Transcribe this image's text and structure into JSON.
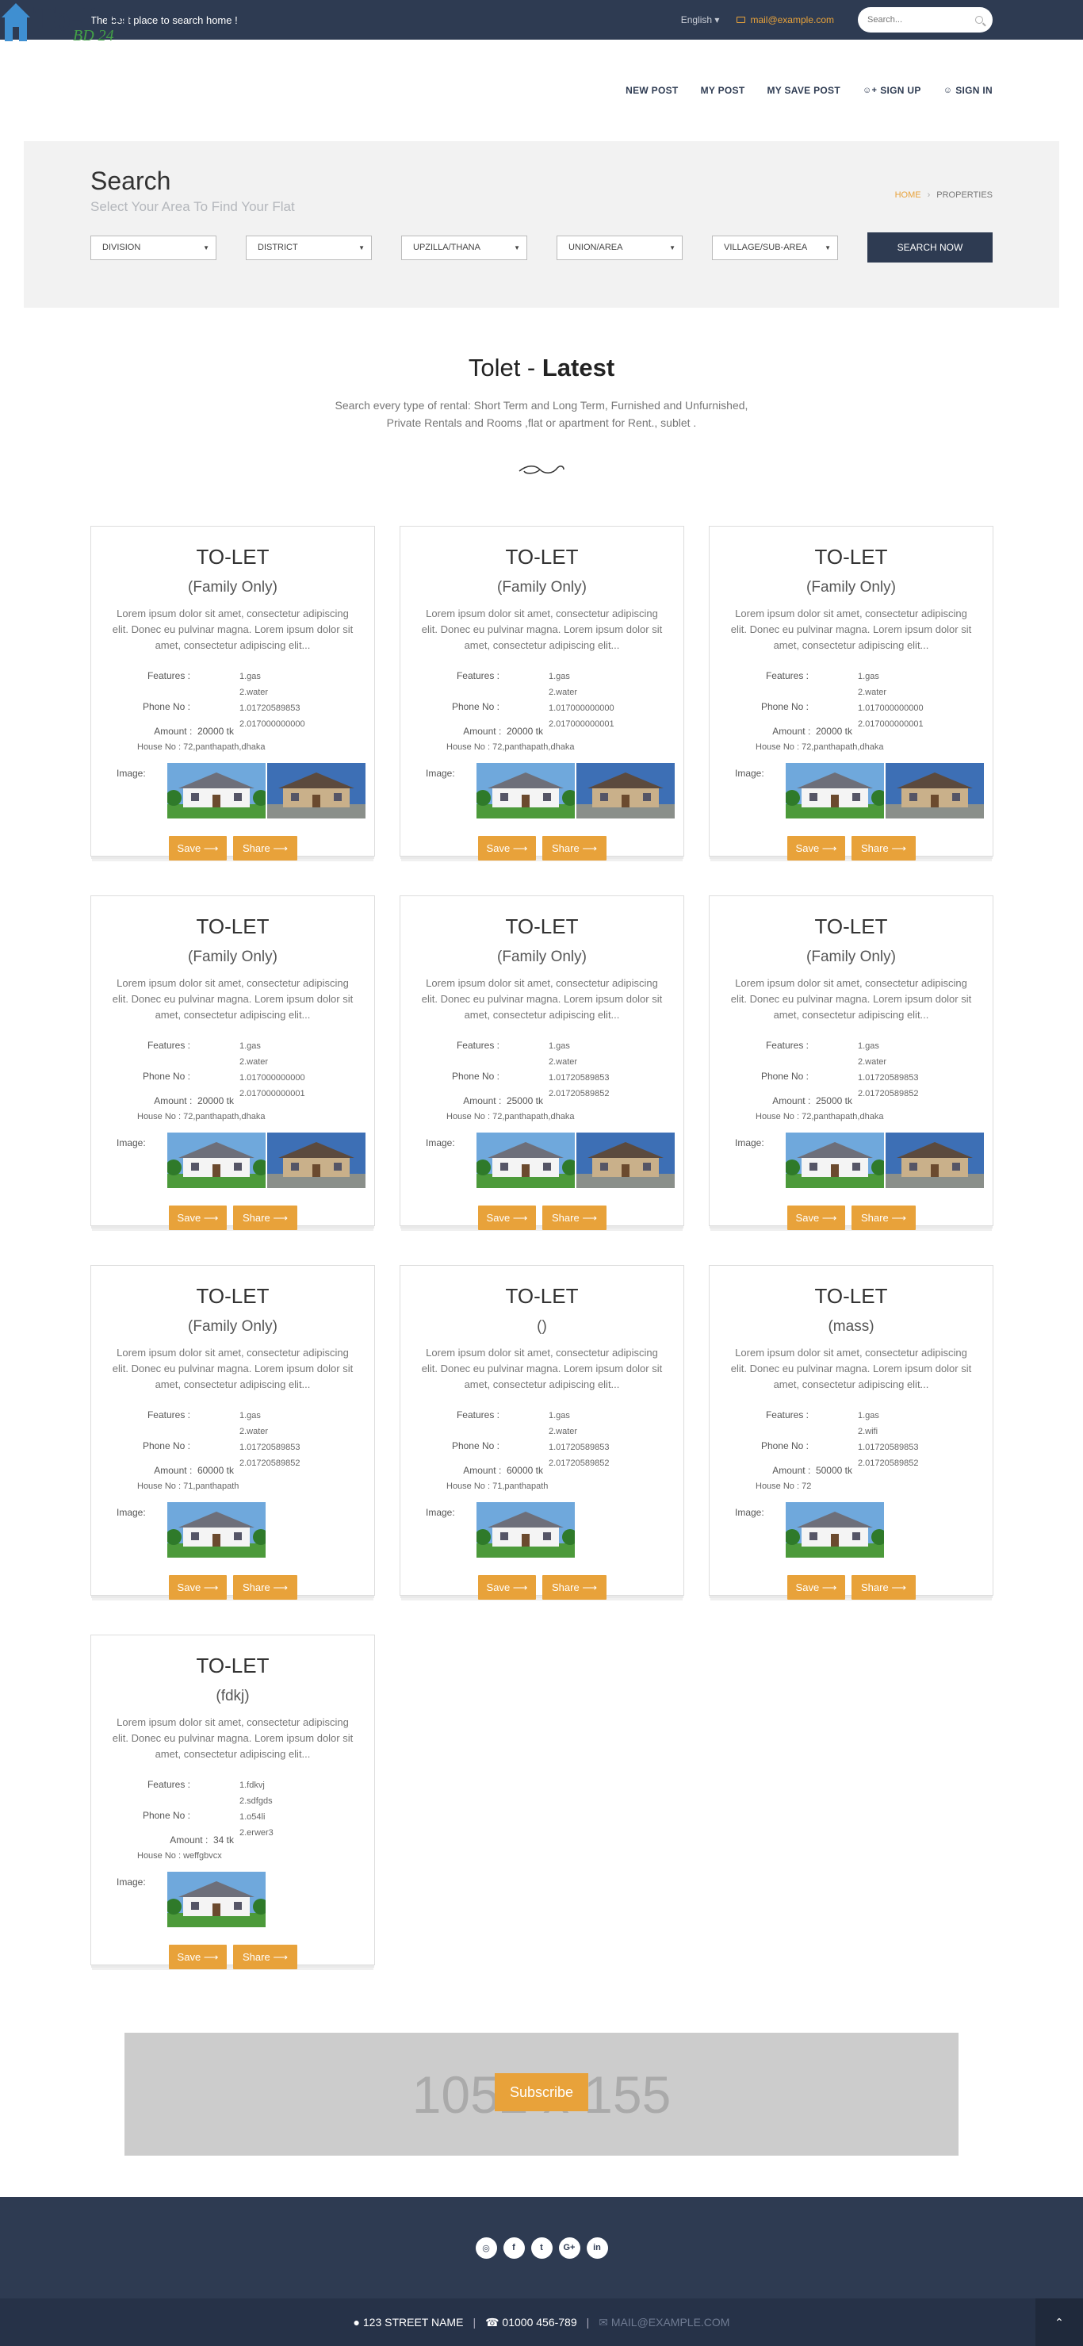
{
  "topbar": {
    "tagline": "The best place to search home !",
    "language": "English",
    "email": "mail@example.com",
    "search_placeholder": "Search..."
  },
  "logo": {
    "title": "To-Let",
    "sub": "BD 24"
  },
  "nav": [
    {
      "label": "NEW POST",
      "icon": ""
    },
    {
      "label": "MY POST",
      "icon": ""
    },
    {
      "label": "MY SAVE POST",
      "icon": ""
    },
    {
      "label": "SIGN UP",
      "icon": "user-plus-icon"
    },
    {
      "label": "SIGN IN",
      "icon": "user-icon"
    }
  ],
  "hero": {
    "title": "Search",
    "subtitle": "Select Your Area To Find Your Flat",
    "breadcrumb_home": "HOME",
    "breadcrumb_current": "PROPERTIES",
    "filters": [
      "DIVISION",
      "DISTRICT",
      "UPZILLA/THANA",
      "UNION/AREA",
      "VILLAGE/SUB-AREA"
    ],
    "search_button": "SEARCH NOW"
  },
  "latest": {
    "title_a": "Tolet - ",
    "title_b": "Latest",
    "text": "Search every type of rental: Short Term and Long Term, Furnished and Unfurnished, Private Rentals and Rooms ,flat or apartment for Rent., sublet ."
  },
  "card_labels": {
    "features": "Features :",
    "phone": "Phone No :",
    "amount": "Amount :",
    "image": "Image:",
    "save": "Save ⟶",
    "share": "Share ⟶"
  },
  "listings": [
    {
      "title": "TO-LET",
      "type": "(Family Only)",
      "desc": "Lorem ipsum dolor sit amet, consectetur adipiscing elit. Donec eu pulvinar magna. Lorem ipsum dolor sit amet, consectetur adipiscing elit...",
      "features": [
        "1.gas",
        "2.water"
      ],
      "phones": [
        "1.01720589853",
        "2.017000000000"
      ],
      "amount": "20000 tk",
      "house": "House No : 72,panthapath,dhaka",
      "images": 2
    },
    {
      "title": "TO-LET",
      "type": "(Family Only)",
      "desc": "Lorem ipsum dolor sit amet, consectetur adipiscing elit. Donec eu pulvinar magna. Lorem ipsum dolor sit amet, consectetur adipiscing elit...",
      "features": [
        "1.gas",
        "2.water"
      ],
      "phones": [
        "1.017000000000",
        "2.017000000001"
      ],
      "amount": "20000 tk",
      "house": "House No : 72,panthapath,dhaka",
      "images": 2
    },
    {
      "title": "TO-LET",
      "type": "(Family Only)",
      "desc": "Lorem ipsum dolor sit amet, consectetur adipiscing elit. Donec eu pulvinar magna. Lorem ipsum dolor sit amet, consectetur adipiscing elit...",
      "features": [
        "1.gas",
        "2.water"
      ],
      "phones": [
        "1.017000000000",
        "2.017000000001"
      ],
      "amount": "20000 tk",
      "house": "House No : 72,panthapath,dhaka",
      "images": 2
    },
    {
      "title": "TO-LET",
      "type": "(Family Only)",
      "desc": "Lorem ipsum dolor sit amet, consectetur adipiscing elit. Donec eu pulvinar magna. Lorem ipsum dolor sit amet, consectetur adipiscing elit...",
      "features": [
        "1.gas",
        "2.water"
      ],
      "phones": [
        "1.017000000000",
        "2.017000000001"
      ],
      "amount": "20000 tk",
      "house": "House No : 72,panthapath,dhaka",
      "images": 2
    },
    {
      "title": "TO-LET",
      "type": "(Family Only)",
      "desc": "Lorem ipsum dolor sit amet, consectetur adipiscing elit. Donec eu pulvinar magna. Lorem ipsum dolor sit amet, consectetur adipiscing elit...",
      "features": [
        "1.gas",
        "2.water"
      ],
      "phones": [
        "1.01720589853",
        "2.01720589852"
      ],
      "amount": "25000 tk",
      "house": "House No : 72,panthapath,dhaka",
      "images": 2
    },
    {
      "title": "TO-LET",
      "type": "(Family Only)",
      "desc": "Lorem ipsum dolor sit amet, consectetur adipiscing elit. Donec eu pulvinar magna. Lorem ipsum dolor sit amet, consectetur adipiscing elit...",
      "features": [
        "1.gas",
        "2.water"
      ],
      "phones": [
        "1.01720589853",
        "2.01720589852"
      ],
      "amount": "25000 tk",
      "house": "House No : 72,panthapath,dhaka",
      "images": 2
    },
    {
      "title": "TO-LET",
      "type": "(Family Only)",
      "desc": "Lorem ipsum dolor sit amet, consectetur adipiscing elit. Donec eu pulvinar magna. Lorem ipsum dolor sit amet, consectetur adipiscing elit...",
      "features": [
        "1.gas",
        "2.water"
      ],
      "phones": [
        "1.01720589853",
        "2.01720589852"
      ],
      "amount": "60000 tk",
      "house": "House No : 71,panthapath",
      "images": 1
    },
    {
      "title": "TO-LET",
      "type": "()",
      "desc": "Lorem ipsum dolor sit amet, consectetur adipiscing elit. Donec eu pulvinar magna. Lorem ipsum dolor sit amet, consectetur adipiscing elit...",
      "features": [
        "1.gas",
        "2.water"
      ],
      "phones": [
        "1.01720589853",
        "2.01720589852"
      ],
      "amount": "60000 tk",
      "house": "House No : 71,panthapath",
      "images": 1
    },
    {
      "title": "TO-LET",
      "type": "(mass)",
      "desc": "Lorem ipsum dolor sit amet, consectetur adipiscing elit. Donec eu pulvinar magna. Lorem ipsum dolor sit amet, consectetur adipiscing elit...",
      "features": [
        "1.gas",
        "2.wifi"
      ],
      "phones": [
        "1.01720589853",
        "2.01720589852"
      ],
      "amount": "50000 tk",
      "house": "House No : 72",
      "images": 1
    },
    {
      "title": "TO-LET",
      "type": "(fdkj)",
      "desc": "Lorem ipsum dolor sit amet, consectetur adipiscing elit. Donec eu pulvinar magna. Lorem ipsum dolor sit amet, consectetur adipiscing elit...",
      "features": [
        "1.fdkvj",
        "2.sdfgds"
      ],
      "phones": [
        "1.o54li",
        "2.erwer3"
      ],
      "amount": "34 tk",
      "house": "House No : weffgbvcx",
      "images": 1
    }
  ],
  "ad": {
    "placeholder": "1052 x 155",
    "button": "Subscribe"
  },
  "social": [
    "instagram-icon",
    "facebook-icon",
    "twitter-icon",
    "google-plus-icon",
    "linkedin-icon"
  ],
  "footer": {
    "address": "123 STREET NAME",
    "phone": "01000 456-789",
    "email": "MAIL@EXAMPLE.COM"
  },
  "colors": {
    "navy": "#2e3b52",
    "orange": "#e8a23a"
  }
}
